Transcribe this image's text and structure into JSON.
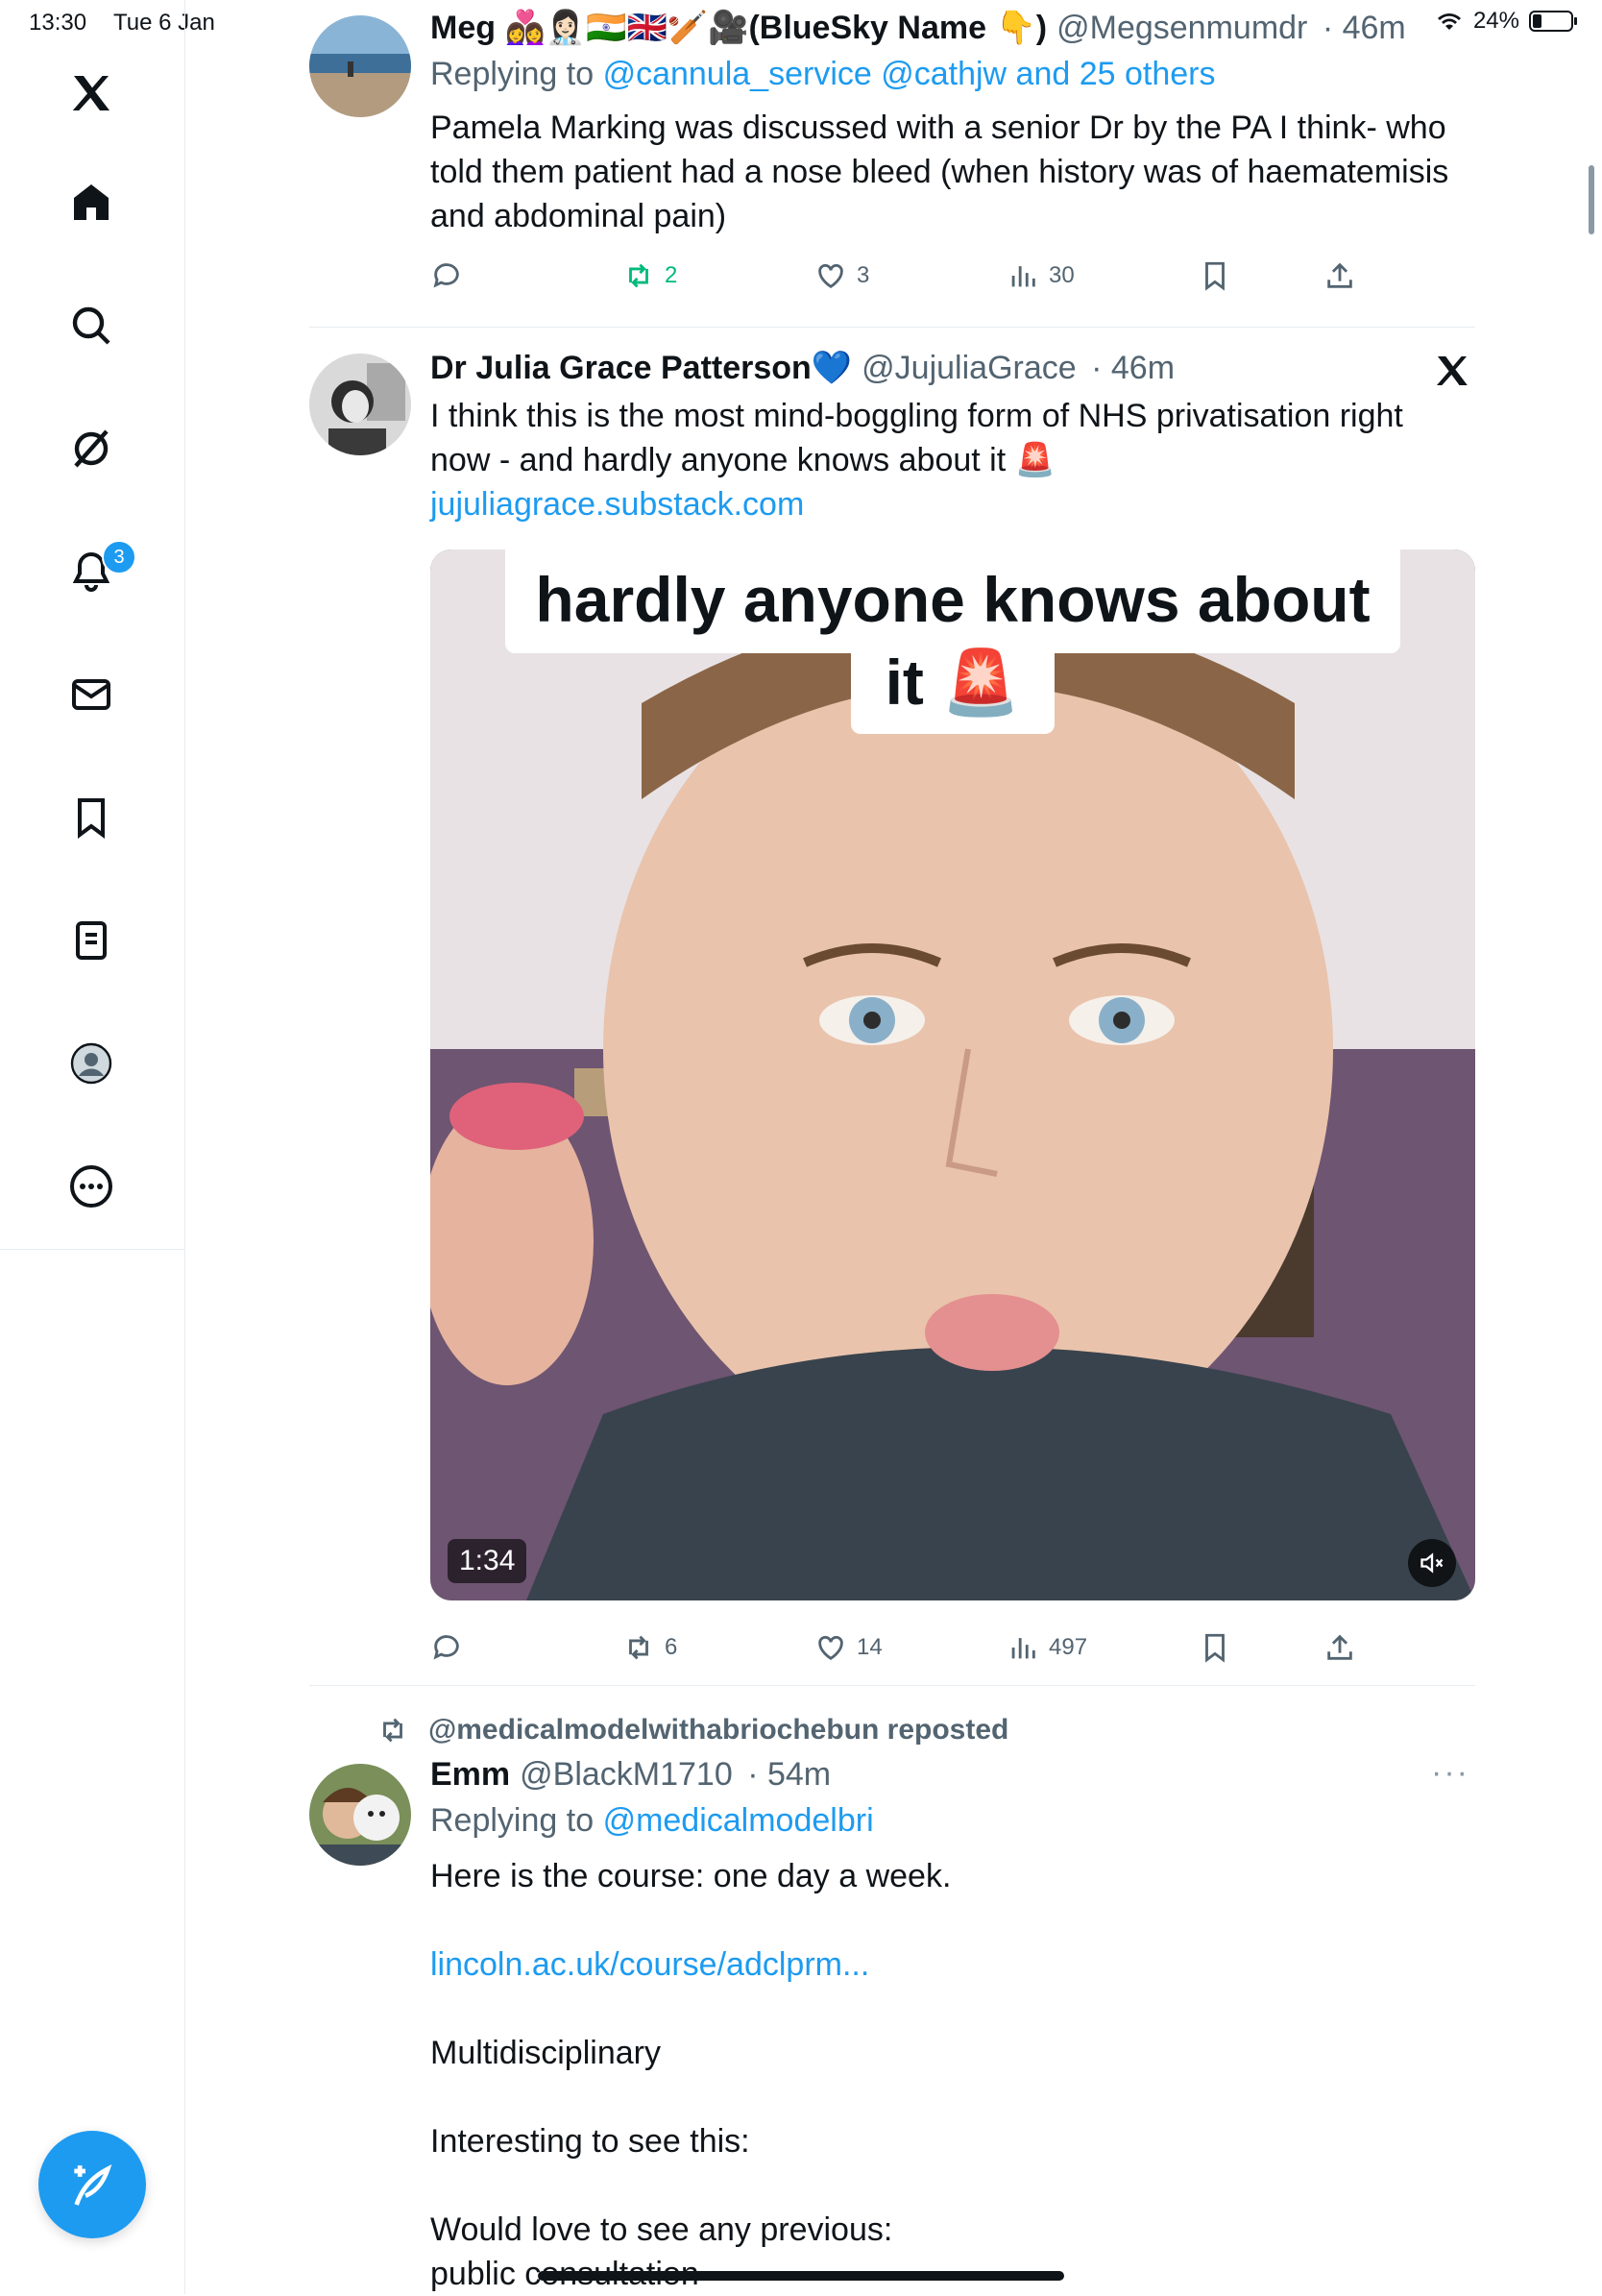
{
  "status": {
    "time": "13:30",
    "date": "Tue 6 Jan",
    "battery": "24%",
    "battery_level": 0.24
  },
  "sidebar": {
    "items": [
      {
        "name": "x-logo"
      },
      {
        "name": "home"
      },
      {
        "name": "search"
      },
      {
        "name": "grok"
      },
      {
        "name": "notifications"
      },
      {
        "name": "messages"
      },
      {
        "name": "bookmarks"
      },
      {
        "name": "lists"
      },
      {
        "name": "profile"
      },
      {
        "name": "more"
      }
    ],
    "notification_count": "3"
  },
  "tweets": [
    {
      "name": "Meg 👩‍❤️‍👩👩🏻‍⚕️🇮🇳🇬🇧🏏🎥(BlueSky Name 👇)",
      "handle": "@Megsenmumdr",
      "time": "· 46m",
      "reply_prefix": "Replying to",
      "reply_targets": "@cannula_service @cathjw and 25 others",
      "text_lines": [
        "Pamela Marking was discussed with a senior Dr by the PA I think- who",
        "told them patient had a nose bleed (when history was of haematemisis",
        "and abdominal pain)"
      ],
      "replies": "",
      "reposts": "2",
      "likes": "3",
      "views": "30"
    },
    {
      "name": "Dr Julia Grace Patterson💙",
      "handle": "@JujuliaGrace",
      "time": "· 46m",
      "text_lines": [
        "I think this is the most mind-boggling form of NHS privatisation right",
        "now - and hardly anyone knows about it 🚨"
      ],
      "link": "jujuliagrace.substack.com",
      "video": {
        "caption_line1": "hardly anyone knows about",
        "caption_line2": "it 🚨",
        "duration": "1:34"
      },
      "replies": "",
      "reposts": "6",
      "likes": "14",
      "views": "497"
    },
    {
      "repost_label": "@medicalmodelwithabriochebun reposted",
      "name": "Emm",
      "handle": "@BlackM1710",
      "time": "· 54m",
      "reply_prefix": "Replying to",
      "reply_targets": "@medicalmodelbri",
      "text_lines": [
        "Here is the course: one day a week.",
        "",
        "lincoln.ac.uk/course/adclprm...",
        "",
        "Multidisciplinary",
        "",
        "Interesting to see this:",
        "",
        "Would love to see any previous:",
        "public consultation"
      ],
      "more_menu": "···"
    }
  ],
  "colors": {
    "accent": "#1d9bf0",
    "repost_green": "#00ba7c",
    "text": "#0f1419",
    "muted": "#536471"
  }
}
